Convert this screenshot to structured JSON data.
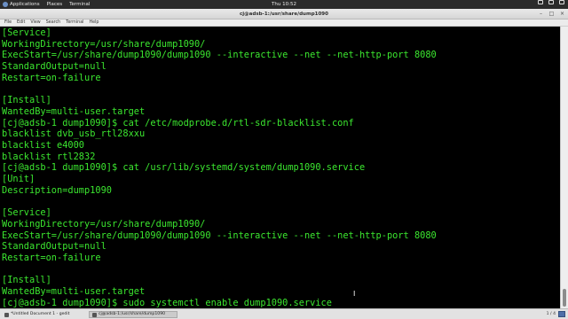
{
  "topbar": {
    "applications": "Applications",
    "places": "Places",
    "terminal": "Terminal",
    "clock": "Thu 10:52"
  },
  "window": {
    "title": "cj@adsb-1:/usr/share/dump1090",
    "minimize": "–",
    "maximize": "□",
    "close": "×"
  },
  "menu": [
    "File",
    "Edit",
    "View",
    "Search",
    "Terminal",
    "Help"
  ],
  "terminal": {
    "lines": [
      "[Service]",
      "WorkingDirectory=/usr/share/dump1090/",
      "ExecStart=/usr/share/dump1090/dump1090 --interactive --net --net-http-port 8080",
      "StandardOutput=null",
      "Restart=on-failure",
      "",
      "[Install]",
      "WantedBy=multi-user.target",
      "[cj@adsb-1 dump1090]$ cat /etc/modprobe.d/rtl-sdr-blacklist.conf",
      "blacklist dvb_usb_rtl28xxu",
      "blacklist e4000",
      "blacklist rtl2832",
      "[cj@adsb-1 dump1090]$ cat /usr/lib/systemd/system/dump1090.service",
      "[Unit]",
      "Description=dump1090",
      "",
      "[Service]",
      "WorkingDirectory=/usr/share/dump1090/",
      "ExecStart=/usr/share/dump1090/dump1090 --interactive --net --net-http-port 8080",
      "StandardOutput=null",
      "Restart=on-failure",
      "",
      "[Install]",
      "WantedBy=multi-user.target",
      "[cj@adsb-1 dump1090]$ sudo systemctl enable dump1090.service"
    ],
    "color": "#3be62f"
  },
  "taskbar": {
    "task1": "*Untitled Document 1 - gedit",
    "task2": "cj@adsb-1:/usr/share/dump1090",
    "pager": "1 / 4"
  }
}
